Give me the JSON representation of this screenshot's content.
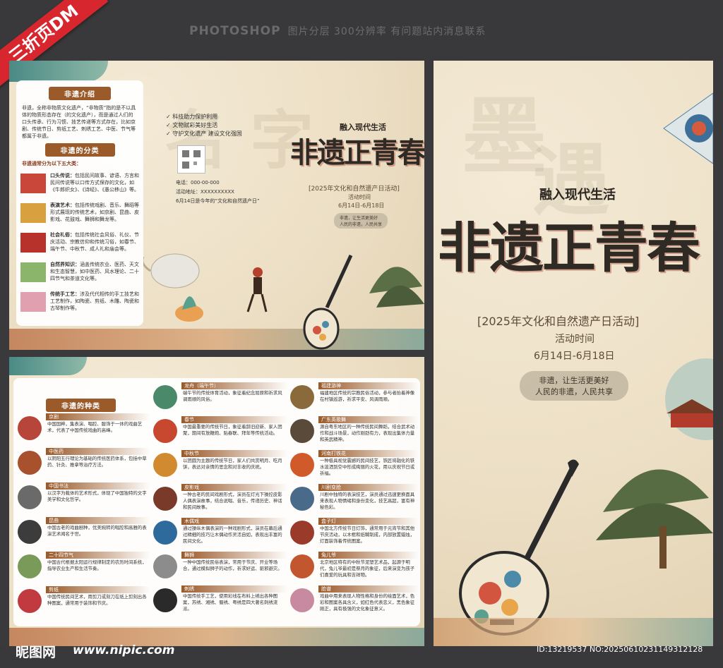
{
  "header": {
    "ribbon": "三折页DM",
    "brand": "PHOTOSHOP",
    "note": "图片分层 300分辨率 有问题站内消息联系"
  },
  "flyer": {
    "slogan_top": "融入现代生活",
    "title": "非遗正青春",
    "event": "[2025年文化和自然遗产日活动]",
    "time_label": "活动时间",
    "dates": "6月14日-6月18日",
    "motto1": "非遗，让生活更美好",
    "motto2": "人民的非遗，人民共享",
    "checks": [
      "科技助力保护利用",
      "文物赋彩美好生活",
      "守护文化遗产  建设文化强国"
    ],
    "phone": "电话：000-00-000",
    "address": "活动地址：XXXXXXXXXX",
    "day_note": "6月14日是今年的“文化和自然遗产日”"
  },
  "intro": {
    "heading1": "非遗介绍",
    "intro_text": "非遗，全称非物质文化遗产，“非物质”指的是不以具体的物质形态存在（的文化遗产），而是通过人们的口头传承、行为习惯、技艺传递等方式存在，比如京剧、传统节日、剪纸工艺、刺绣工艺、中医、节气等都属于非遗。",
    "heading2": "非遗的分类",
    "sub": "非遗通常分为以下五大类：",
    "categories": [
      {
        "name": "口头传说：",
        "text": "包括民间故事、谚语、方言和民间传说等以口传方式保存的文化，如《牛郎织女》、《诗经》、《愚公移山》等。"
      },
      {
        "name": "表演艺术：",
        "text": "包括传统戏剧、音乐、舞蹈等形式展现的传统艺术，如京剧、昆曲、皮影戏、花鼓戏、舞狮和舞龙等。"
      },
      {
        "name": "社会礼俗：",
        "text": "包括传统社会风俗、礼仪、节庆活动、宗教信仰和传统习俗，如春节、端午节、中秋节、成人礼和庙会等。"
      },
      {
        "name": "自然界知识：",
        "text": "涵盖传统农业、医药、天文和生态智慧，如中医药、风水理论、二十四节气和茶道文化等。"
      },
      {
        "name": "传统手工艺：",
        "text": "涉及代代相传的手工技艺和工艺制作，如陶瓷、剪纸、木雕、陶瓷和古琴制作等。"
      }
    ]
  },
  "kinds": {
    "heading": "非遗的种类",
    "col1": [
      {
        "name": "京剧",
        "text": "中国国粹，集表演、唱腔、服饰于一体的戏曲艺术，代表了中国传统戏曲的高峰。"
      },
      {
        "name": "中医药",
        "text": "以阴阳五行理论为基础的传统医药体系，包括中草药、针灸、推拿等治疗方法。"
      },
      {
        "name": "中国书法",
        "text": "以汉字为载体的艺术形式，体现了中国独特的文字美学和文化哲学。"
      },
      {
        "name": "昆曲",
        "text": "中国古老的戏曲剧种，优美婉转的唱腔和高雅的表演艺术闻名于世。"
      },
      {
        "name": "二十四节气",
        "text": "中国古代根据太阳运行规律制定的农历时间系统，指导农业生产和生活节奏。"
      },
      {
        "name": "剪纸",
        "text": "中国传统民间艺术，用剪刀或刻刀在纸上剪刻出各种图案，通常用于装饰和节庆。"
      }
    ],
    "col2": [
      {
        "name": "龙舟（端午节）",
        "text": "端午节的传统体育活动，象征着纪念屈原和祈求风调雨顺的风俗。"
      },
      {
        "name": "春节",
        "text": "中国最重要的传统节日，象征着辞旧迎新、家人团聚，期间有放鞭炮、贴春联、拜年等传统活动。"
      },
      {
        "name": "中秋节",
        "text": "以团圆为主题的传统节日，家人们共赏明月、吃月饼，表达对亲情的思念和对丰收的庆祝。"
      },
      {
        "name": "皮影戏",
        "text": "一种古老的民间戏剧形式，演员在灯光下操控皮影人偶表演故事，结合说唱、音乐，传递历史、神话和民间故事。"
      },
      {
        "name": "木偶戏",
        "text": "通过操纵木偶表演的一种戏剧形式，演员在幕后通过精细的技巧让木偶动作灵活自如，表现出丰富的民间文化。"
      },
      {
        "name": "舞狮",
        "text": "一种中国传统民俗表演，常用于节庆、开业等场合，通过模拟狮子的动作，祈求好运、驱邪避灾。"
      },
      {
        "name": "刺绣",
        "text": "中国传统手工艺，使用彩线在布料上绣出各种图案，苏绣、湘绣、蜀绣、粤绣是四大著名刺绣流派。"
      }
    ],
    "col3": [
      {
        "name": "福建游神",
        "text": "福建地区传统的宗教民俗活动，参与者抬着神像在村镇巡游，祈求平安、风调雨顺。"
      },
      {
        "name": "广东英歌舞",
        "text": "源自粤东地区的一种传统民间舞蹈，结合武术动作和战斗场景，动作刚劲有力，表现出集体力量和英武精神。"
      },
      {
        "name": "河南打铁花",
        "text": "一种极具视觉震撼的民间技艺，铁匠将融化的铁水泼洒到空中形成绚丽的火花，用以庆祝节日或祈福。"
      },
      {
        "name": "川剧变脸",
        "text": "川剧中独特的表演技艺，演员通过迅速更换面具来表现人物情绪和身份变化，技艺高超，富有神秘色彩。"
      },
      {
        "name": "盒子灯",
        "text": "中国北方传统节日灯饰，通常用于元宵节和其他节庆活动，以木框和纸糊制成，内部放置蜡烛，灯面装饰着传统图案。"
      },
      {
        "name": "兔儿爷",
        "text": "北京地区特有的中秋节泥塑艺术品，起源于明代，兔儿爷最初是祭月的象征，后来演变为孩子们喜爱的玩具和吉祥物。"
      },
      {
        "name": "脸谱",
        "text": "戏曲中用来表现人物性格和身份的绘面艺术，色彩和图案各具含义，如红色代表忠义，黑色象征刚正，具有极强的文化象征意义。"
      }
    ]
  },
  "footer": {
    "site": "昵图网",
    "url": "www.nipic.com",
    "id": "ID:13219537 NO:20250610231149312128"
  },
  "colors": {
    "accent": "#9a5a2a",
    "ribbon": "#d8262f",
    "bg": "#3a3a3c"
  }
}
